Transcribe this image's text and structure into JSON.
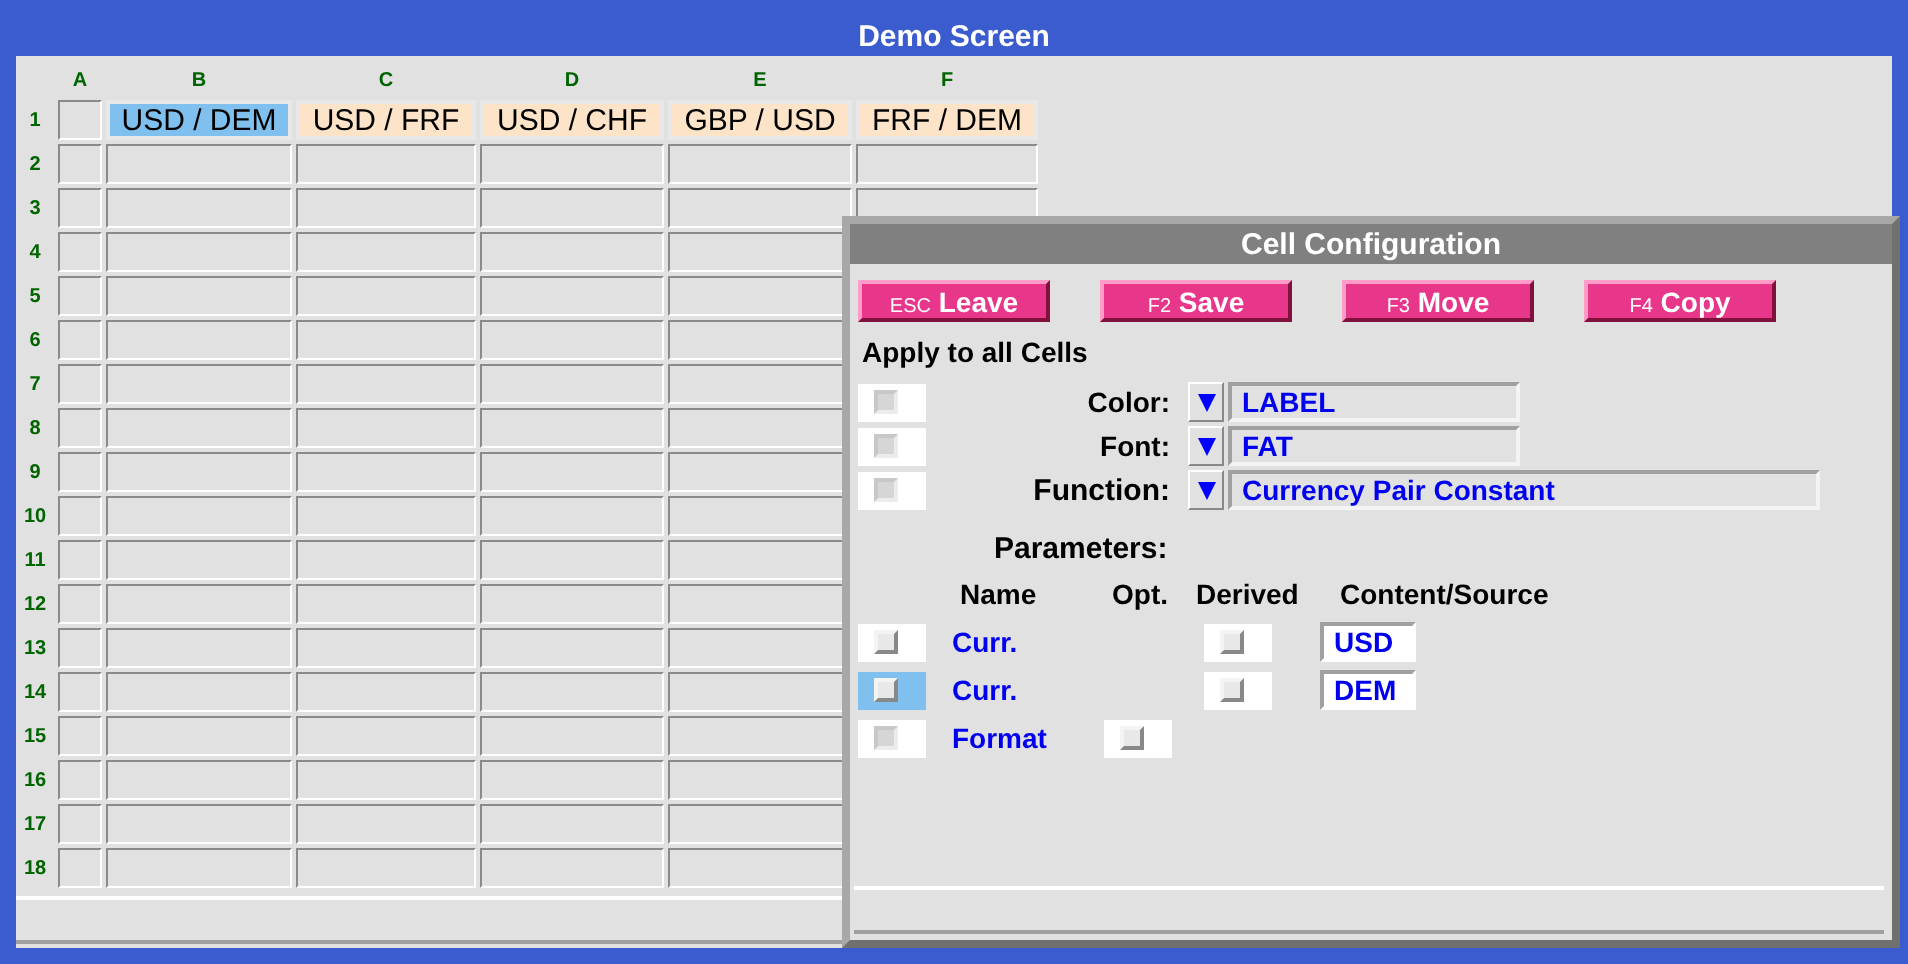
{
  "window": {
    "title": "Demo Screen"
  },
  "sheet": {
    "columns": [
      "A",
      "B",
      "C",
      "D",
      "E",
      "F"
    ],
    "rows": [
      {
        "label": "1",
        "cells": [
          {
            "text": "USD / DEM",
            "selected": true
          },
          {
            "text": "USD / FRF",
            "selected": false
          },
          {
            "text": "USD / CHF",
            "selected": false
          },
          {
            "text": "GBP / USD",
            "selected": false
          },
          {
            "text": "FRF / DEM",
            "selected": false
          }
        ]
      },
      {
        "label": "2"
      },
      {
        "label": "3"
      },
      {
        "label": "4"
      },
      {
        "label": "5"
      },
      {
        "label": "6"
      },
      {
        "label": "7"
      },
      {
        "label": "8"
      },
      {
        "label": "9"
      },
      {
        "label": "10"
      },
      {
        "label": "11"
      },
      {
        "label": "12"
      },
      {
        "label": "13"
      },
      {
        "label": "14"
      },
      {
        "label": "15"
      },
      {
        "label": "16"
      },
      {
        "label": "17"
      },
      {
        "label": "18"
      }
    ]
  },
  "dialog": {
    "title": "Cell Configuration",
    "buttons": [
      {
        "key": "ESC",
        "label": "Leave"
      },
      {
        "key": "F2",
        "label": "Save"
      },
      {
        "key": "F3",
        "label": "Move"
      },
      {
        "key": "F4",
        "label": "Copy"
      }
    ],
    "apply_label": "Apply to all Cells",
    "settings": [
      {
        "kind": "attribute",
        "label": "Color:",
        "value": "LABEL",
        "disabled": true
      },
      {
        "kind": "attribute",
        "label": "Font:",
        "value": "FAT",
        "disabled": true
      },
      {
        "kind": "function",
        "label": "Function:",
        "value": "Currency Pair Constant",
        "disabled": true
      }
    ],
    "parameters_label": "Parameters:",
    "param_columns": [
      "Name",
      "Opt.",
      "Derived",
      "Content/Source"
    ],
    "parameters": [
      {
        "kind": "currency",
        "name": "Curr.",
        "content": "USD",
        "derived_checked": false,
        "selected": false,
        "disabled": false
      },
      {
        "kind": "currency",
        "name": "Curr.",
        "content": "DEM",
        "derived_checked": false,
        "selected": true,
        "disabled": false
      },
      {
        "kind": "format",
        "name": "Format",
        "opt_checked": false,
        "selected": false,
        "disabled": true
      }
    ]
  }
}
